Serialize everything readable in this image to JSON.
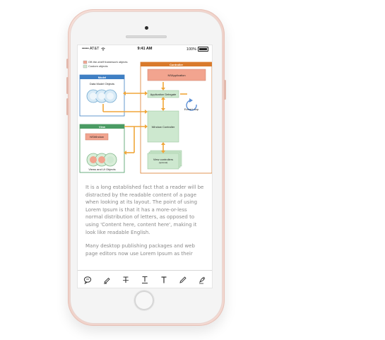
{
  "status_bar": {
    "carrier": "••••• AT&T",
    "time": "9:41 AM",
    "battery": "100%"
  },
  "diagram": {
    "legend": [
      {
        "label": "Off-the-shelf framework objects",
        "color": "#f2a48f"
      },
      {
        "label": "Custom objects",
        "color": "#cde8cf"
      }
    ],
    "model_title": "Model",
    "model_label": "Data Model Objects",
    "view_title": "View",
    "view_nswindow": "NSWindow",
    "view_label": "Views and UI Objects",
    "controller_title": "Controller",
    "nsapplication": "NSApplication",
    "app_delegate": "Application Delegate",
    "event_loop": "Event Loop",
    "window_controller": "Window Controller",
    "view_controllers": "View controllers",
    "view_controllers_note": "(optional)",
    "colors": {
      "model": "#3f7fc4",
      "view": "#4a9b63",
      "controller": "#d97a2b",
      "arrow": "#f0a63a"
    }
  },
  "body": {
    "paragraph1": "It is a long established fact that a reader will be distracted by the readable content of a page when looking at its layout. The point of using Lorem Ipsum is that it has a more-or-less normal distribution of letters, as opposed to using 'Content here, content here', making it look like readable English.",
    "paragraph2": "Many desktop publishing packages and web page editors now use Lorem Ipsum as their"
  },
  "toolbar": {
    "tools": [
      "comment-icon",
      "highlighter-icon",
      "text-strikethrough-icon",
      "text-underline-icon",
      "text-icon",
      "pencil-icon",
      "pen-icon"
    ]
  }
}
